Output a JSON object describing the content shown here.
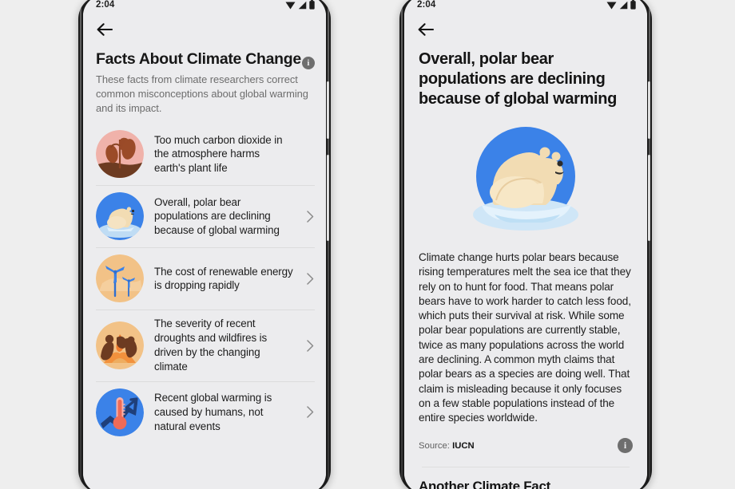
{
  "left_phone": {
    "status_bar": {
      "time": "2:04",
      "icons": [
        "wifi-icon",
        "signal-icon",
        "battery-icon"
      ]
    },
    "back_label": "Back",
    "title": "Facts About Climate Change",
    "title_info_glyph": "i",
    "subtitle": "These facts from climate researchers correct common misconceptions about global warming and its impact.",
    "facts": [
      {
        "text": "Too much carbon dioxide in the atmosphere harms earth's plant life",
        "icon": "co2-plant-icon",
        "has_chevron": false
      },
      {
        "text": "Overall, polar bear populations are declining because of global warming",
        "icon": "polar-bear-icon",
        "has_chevron": true
      },
      {
        "text": "The cost of renewable energy is dropping rapidly",
        "icon": "wind-turbine-icon",
        "has_chevron": true
      },
      {
        "text": "The severity of recent droughts and wildfires is driven by the changing climate",
        "icon": "wildfire-icon",
        "has_chevron": true
      },
      {
        "text": "Recent global warming is caused by humans, not natural events",
        "icon": "thermometer-icon",
        "has_chevron": true
      }
    ]
  },
  "right_phone": {
    "status_bar": {
      "time": "2:04",
      "icons": [
        "wifi-icon",
        "signal-icon",
        "battery-icon"
      ]
    },
    "back_label": "Back",
    "title": "Overall, polar bear populations are declining because of global warming",
    "hero_icon": "polar-bear-on-ice-illustration",
    "body": "Climate change hurts polar bears because rising temperatures melt the sea ice that they rely on to hunt for food. That means polar bears have to work harder to catch less food, which puts their survival at risk. While some polar bear populations are currently stable, twice as many populations across the world are declining. A common myth claims that polar bears as a species are doing well. That claim is misleading because it only focuses on a few stable populations instead of the entire species worldwide.",
    "source_prefix": "Source: ",
    "source_name": "IUCN",
    "info_glyph": "i",
    "next_section": "Another Climate Fact"
  },
  "colors": {
    "background": "#eeeeee",
    "screen": "#ececee",
    "frame": "#1b1b1b",
    "text_primary": "#1c1c1c",
    "text_secondary": "#6d6d6d",
    "divider": "#dcdcdc",
    "info_badge": "#6e6e6e",
    "bear_blue": "#3b82e8",
    "ice_blue": "#cfe6f7"
  }
}
